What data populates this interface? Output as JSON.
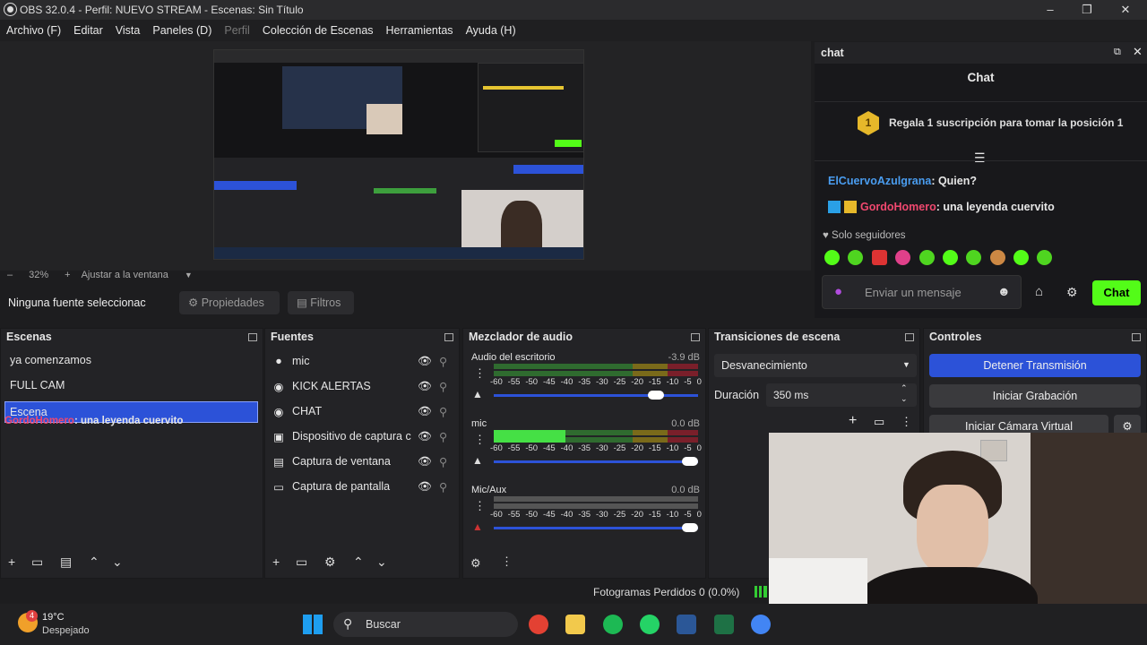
{
  "window": {
    "title": "OBS 32.0.4 - Perfil: NUEVO STREAM - Escenas: Sin Título"
  },
  "menu": [
    "Archivo (F)",
    "Editar",
    "Vista",
    "Paneles (D)",
    "Perfil",
    "Colección de Escenas",
    "Herramientas",
    "Ayuda (H)"
  ],
  "zoom": {
    "value": "32%",
    "fit_label": "Ajustar a la ventana"
  },
  "source_toolbar": {
    "none_selected": "Ninguna fuente seleccionac",
    "properties": "Propiedades",
    "filters": "Filtros"
  },
  "chat": {
    "dock_title": "chat",
    "header": "Chat",
    "pinned_rank": "1",
    "pinned_text": "Regala 1 suscripción para tomar la posición 1",
    "messages": [
      {
        "user": "ElCuervoAzulgrana",
        "text": ": Quien?",
        "color": "#4a9df0"
      },
      {
        "user": "GordoHomero",
        "text": ": una leyenda cuervito",
        "color": "#f0486f"
      }
    ],
    "followers_only": "Solo seguidores",
    "input_placeholder": "Enviar un mensaje",
    "send_label": "Chat",
    "accent": "#53fc18"
  },
  "scenes": {
    "title": "Escenas",
    "items": [
      "ya comenzamos",
      "FULL CAM",
      "Escena"
    ],
    "selected_index": 2,
    "overlay_user": "GordoHomero",
    "overlay_text": ": una leyenda cuervito"
  },
  "sources": {
    "title": "Fuentes",
    "items": [
      {
        "name": "mic",
        "icon": "mic-icon"
      },
      {
        "name": "KICK ALERTAS",
        "icon": "browser-icon"
      },
      {
        "name": "CHAT",
        "icon": "browser-icon"
      },
      {
        "name": "Dispositivo de captura c",
        "icon": "camera-icon"
      },
      {
        "name": "Captura de ventana",
        "icon": "window-icon"
      },
      {
        "name": "Captura de pantalla",
        "icon": "monitor-icon"
      }
    ]
  },
  "mixer": {
    "title": "Mezclador de audio",
    "scale": [
      "-60",
      "-55",
      "-50",
      "-45",
      "-40",
      "-35",
      "-30",
      "-25",
      "-20",
      "-15",
      "-10",
      "-5",
      "0"
    ],
    "channels": [
      {
        "name": "Audio del escritorio",
        "db": "-3.9 dB",
        "level": 0.0,
        "fader": 0.82
      },
      {
        "name": "mic",
        "db": "0.0 dB",
        "level": 0.35,
        "fader": 1.0
      },
      {
        "name": "Mic/Aux",
        "db": "0.0 dB",
        "level": 0.0,
        "fader": 1.0
      }
    ]
  },
  "transitions": {
    "title": "Transiciones de escena",
    "selected": "Desvanecimiento",
    "duration_label": "Duración",
    "duration_value": "350 ms"
  },
  "controls": {
    "title": "Controles",
    "stop_stream": "Detener Transmisión",
    "start_recording": "Iniciar Grabación",
    "start_virtual_cam": "Iniciar Cámara Virtual",
    "accent": "#2c52d8"
  },
  "status": {
    "dropped_frames": "Fotogramas Perdidos 0 (0.0%)"
  },
  "taskbar": {
    "weather_temp": "19°C",
    "weather_desc": "Despejado",
    "weather_badge": "4",
    "search_placeholder": "Buscar"
  }
}
